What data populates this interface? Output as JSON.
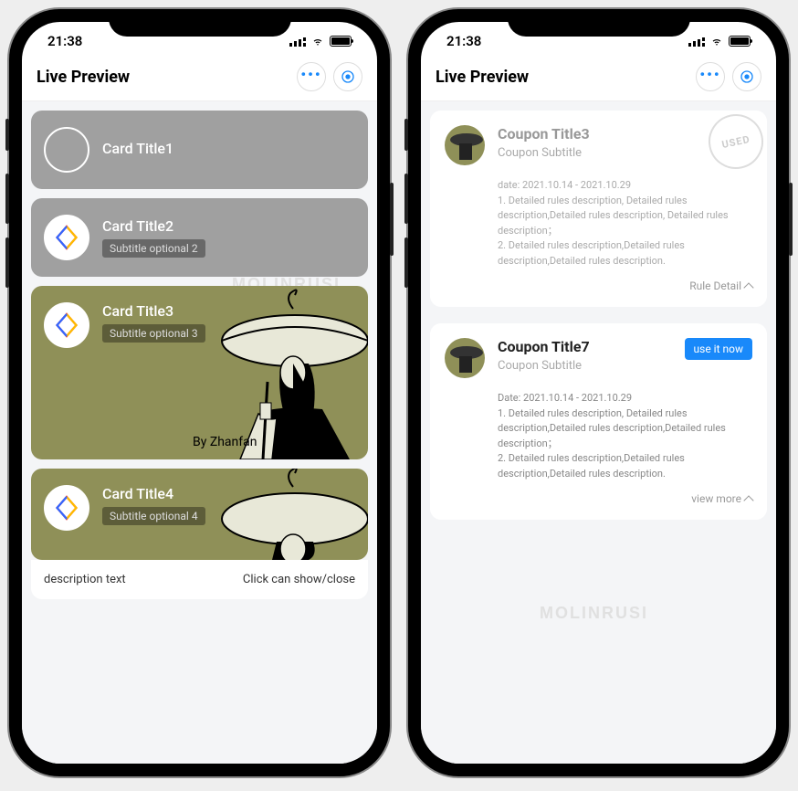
{
  "status": {
    "time": "21:38"
  },
  "header": {
    "title": "Live Preview"
  },
  "phone_left": {
    "cards": [
      {
        "title": "Card Title1"
      },
      {
        "title": "Card Title2",
        "subtitle": "Subtitle optional 2"
      },
      {
        "title": "Card Title3",
        "subtitle": "Subtitle optional 3"
      },
      {
        "title": "Card Title4",
        "subtitle": "Subtitle optional 4"
      }
    ],
    "footer": {
      "desc": "description text",
      "toggle": "Click can show/close"
    },
    "watermark": "MOLINRUSI"
  },
  "phone_right": {
    "coupons": [
      {
        "title": "Coupon Title3",
        "subtitle": "Coupon Subtitle",
        "stamp": "USED",
        "date": "date: 2021.10.14 - 2021.10.29",
        "body": "1. Detailed rules description, Detailed rules description,Detailed rules description, Detailed rules description；\n2. Detailed rules description,Detailed rules description,Detailed rules description.",
        "more": "Rule Detail"
      },
      {
        "title": "Coupon Title7",
        "subtitle": "Coupon Subtitle",
        "action": "use it now",
        "date": "Date: 2021.10.14 - 2021.10.29",
        "body": "1. Detailed rules description, Detailed rules description,Detailed rules description,Detailed rules description；\n2. Detailed rules description,Detailed rules description,Detailed rules description.",
        "more": "view more"
      }
    ],
    "watermark": "MOLINRUSI"
  }
}
